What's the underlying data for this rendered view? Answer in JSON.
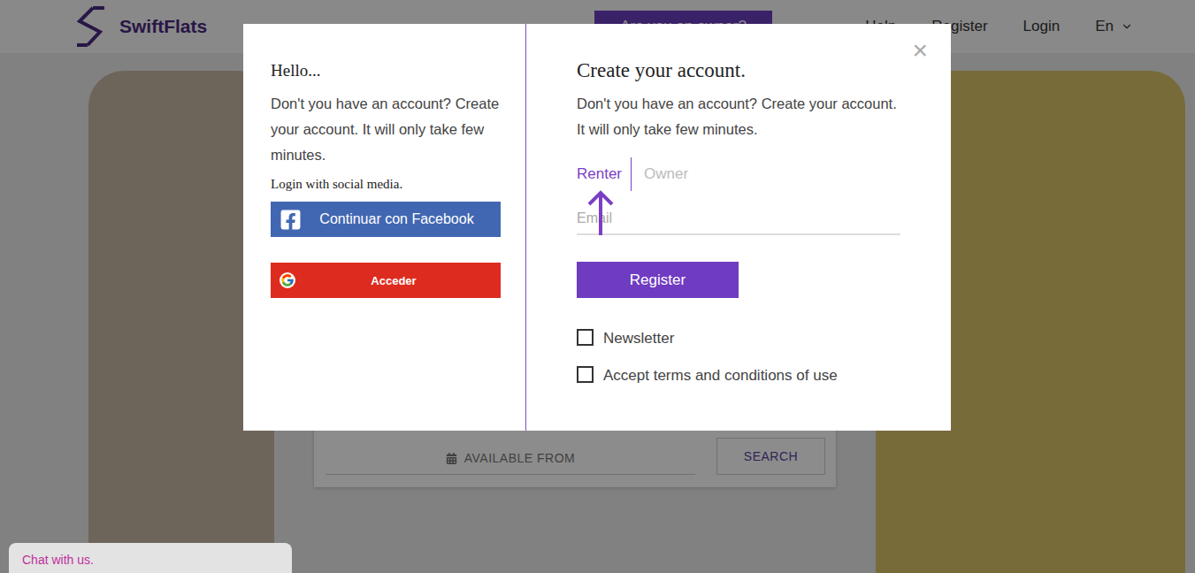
{
  "header": {
    "logo": "SwiftFlats",
    "owner_button": "Are you an owner?",
    "nav": [
      "Help",
      "Register",
      "Login"
    ],
    "language": "En"
  },
  "search": {
    "date_placeholder": "AVAILABLE FROM",
    "button": "SEARCH"
  },
  "chat": {
    "label": "Chat with us."
  },
  "modal": {
    "close": "×",
    "left": {
      "title": "Hello...",
      "text": "Don't you have an account? Create your account. It will only take few minutes.",
      "social_label": "Login with social media.",
      "buttons": [
        {
          "label": "Continuar con Facebook",
          "kind": "facebook",
          "color": "#4267b2"
        },
        {
          "label": "Acceder",
          "kind": "google",
          "color": "#dd2c1f"
        }
      ]
    },
    "right": {
      "title": "Create your account.",
      "text": "Don't you have an account? Create your account. It will only take few minutes.",
      "tabs": [
        {
          "label": "Renter",
          "selected": true
        },
        {
          "label": "Owner",
          "selected": false
        }
      ],
      "email_placeholder": "Email",
      "submit": "Register",
      "checkboxes": [
        {
          "label": "Newsletter",
          "checked": false
        },
        {
          "label": "Accept terms and conditions of use",
          "checked": false
        }
      ]
    }
  }
}
